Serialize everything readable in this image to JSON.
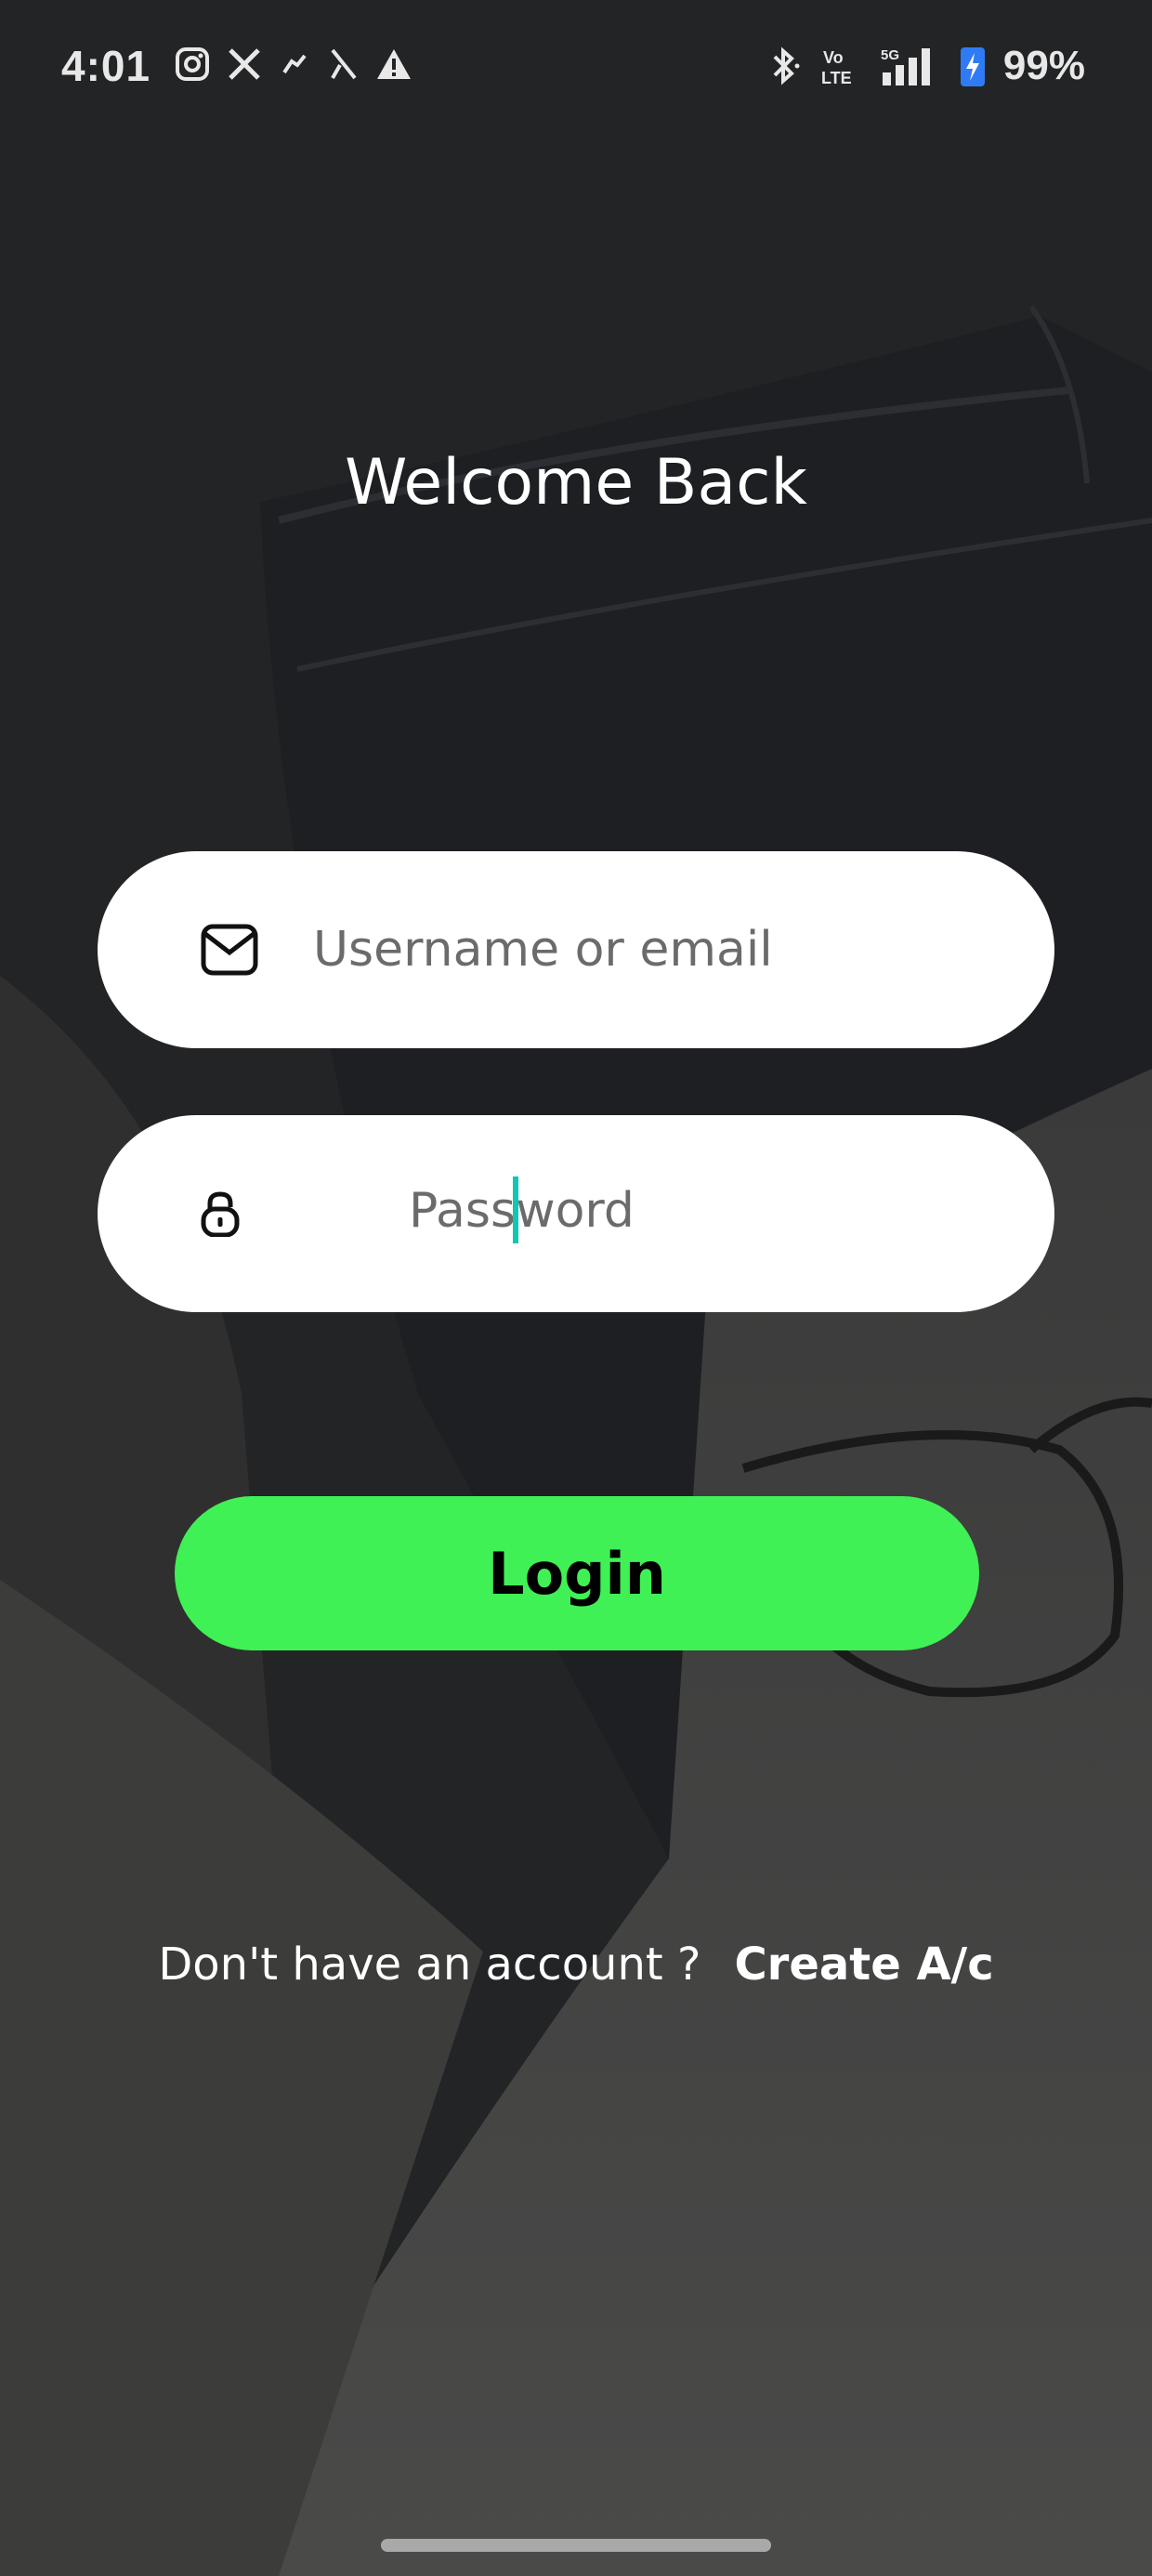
{
  "status_bar": {
    "time": "4:01",
    "battery": "99%",
    "left_icons": [
      "instagram-icon",
      "x-icon",
      "notification-icon",
      "missed-call-icon",
      "alert-icon"
    ],
    "right_icons": [
      "bluetooth-icon",
      "volte-icon",
      "5g-signal-icon",
      "battery-charging-icon"
    ]
  },
  "screen": {
    "title": "Welcome Back"
  },
  "form": {
    "username_placeholder": "Username or email",
    "password_placeholder_before_caret": "Pass",
    "password_placeholder_after_caret": "word",
    "login_label": "Login"
  },
  "footer": {
    "prompt": "Don't have an account ?",
    "create_label": "Create A/c"
  },
  "colors": {
    "accent": "#3ff155",
    "caret": "#10c7b3",
    "overlay": "#232425"
  }
}
